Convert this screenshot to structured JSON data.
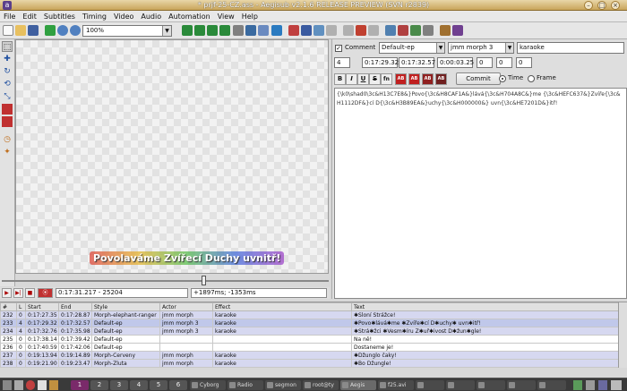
{
  "window": {
    "title": "* prjf-25-CZ.ass - Aegisub v2.1.6 RELEASE PREVIEW (SVN r2839)"
  },
  "menu": [
    "File",
    "Edit",
    "Subtitles",
    "Timing",
    "Video",
    "Audio",
    "Automation",
    "View",
    "Help"
  ],
  "toolbar": {
    "zoom": "100%"
  },
  "video": {
    "subtitle_text": "Povolaváme Zvířecí Duchy uvnitř!",
    "seek_position": 0.62,
    "time_frame": "0:17:31.217 - 25204",
    "offset": "+1897ms; -1353ms"
  },
  "editor": {
    "comment_label": "Comment",
    "style": "Default-ep",
    "actor": "jmm morph 3",
    "effect": "karaoke",
    "layer": "4",
    "start_time": "0:17:29.32",
    "end_time": "0:17:32.57",
    "duration": "0:00:03.25",
    "margin_l": "0",
    "margin_r": "0",
    "margin_v": "0",
    "fmt_bold": "B",
    "fmt_italic": "I",
    "fmt_underline": "U",
    "fmt_strike": "S",
    "fmt_font": "fn",
    "fmt_c1": "AB",
    "fmt_c2": "AB",
    "fmt_c3": "AB",
    "fmt_c4": "AB",
    "commit_label": "Commit",
    "time_label": "Time",
    "frame_label": "Frame",
    "text": "{\\k0\\shad0\\3c&H13C7E8&}Povo{\\3c&H8CAF1A&}lává{\\3c&H704A8C&}me {\\3c&HEFC637&}Zvíře{\\3c&H1112DF&}cí D{\\3c&H3B89EA&}uchy{\\3c&H000000&} uvn{\\3c&HE7201D&}itř!"
  },
  "grid": {
    "headers": [
      "#",
      "L",
      "Start",
      "End",
      "Style",
      "Actor",
      "Effect",
      "Text"
    ],
    "rows": [
      {
        "n": "232",
        "l": "0",
        "start": "0:17:27.35",
        "end": "0:17:28.87",
        "style": "Morph-elephant-ranger",
        "actor": "jmm morph",
        "effect": "karaoke",
        "text": "✱Sloní Strážce!"
      },
      {
        "n": "233",
        "l": "4",
        "start": "0:17:29.32",
        "end": "0:17:32.57",
        "style": "Default-ep",
        "actor": "jmm morph 3",
        "effect": "karaoke",
        "text": "✱Povo✱lává✱me ✱Zvíře✱cí D✱uchy✱ uvn✱itř!"
      },
      {
        "n": "234",
        "l": "4",
        "start": "0:17:32.76",
        "end": "0:17:35.98",
        "style": "Default-ep",
        "actor": "jmm morph 3",
        "effect": "karaoke",
        "text": "✱Strá✱žci ✱Vesm✱íru Z✱uř✱ivost D✱žun✱gle!"
      },
      {
        "n": "235",
        "l": "0",
        "start": "0:17:38.14",
        "end": "0:17:39.42",
        "style": "Default-ep",
        "actor": "",
        "effect": "",
        "text": "Na ně!"
      },
      {
        "n": "236",
        "l": "0",
        "start": "0:17:40.59",
        "end": "0:17:42.06",
        "style": "Default-ep",
        "actor": "",
        "effect": "",
        "text": "Dostaneme je!"
      },
      {
        "n": "237",
        "l": "0",
        "start": "0:19:13.94",
        "end": "0:19:14.89",
        "style": "Morph-Cerveny",
        "actor": "jmm morph",
        "effect": "karaoke",
        "text": "✱Džunglo čaky!"
      },
      {
        "n": "238",
        "l": "0",
        "start": "0:19:21.90",
        "end": "0:19:23.47",
        "style": "Morph-Zluta",
        "actor": "jmm morph",
        "effect": "karaoke",
        "text": "✱Bo Džungle!"
      }
    ]
  },
  "taskbar": {
    "workspaces": [
      "1",
      "2",
      "3",
      "4",
      "5",
      "6"
    ],
    "tasks": [
      "Cyborg",
      "Radio",
      "segmon",
      "root@ty",
      "Aegis",
      "f25.avi",
      "",
      "",
      "",
      "",
      ""
    ]
  }
}
